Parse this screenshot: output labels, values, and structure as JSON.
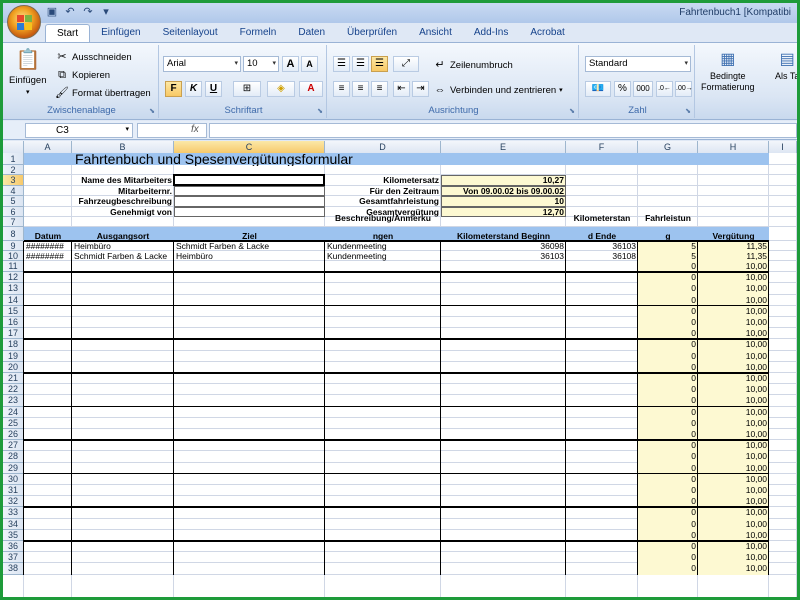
{
  "window": {
    "title": "Fahrtenbuch1  [Kompatibi"
  },
  "qat": [
    {
      "icon": "save-icon",
      "glyph": "▣"
    },
    {
      "icon": "undo-icon",
      "glyph": "↶"
    },
    {
      "icon": "redo-icon",
      "glyph": "↷"
    },
    {
      "icon": "qat-dropdown-icon",
      "glyph": "▾"
    }
  ],
  "tabs": [
    "Start",
    "Einfügen",
    "Seitenlayout",
    "Formeln",
    "Daten",
    "Überprüfen",
    "Ansicht",
    "Add-Ins",
    "Acrobat"
  ],
  "ribbon": {
    "clipboard": {
      "label": "Zwischenablage",
      "paste": "Einfügen",
      "cut": "Ausschneiden",
      "copy": "Kopieren",
      "format_painter": "Format übertragen"
    },
    "font": {
      "label": "Schriftart",
      "name": "Arial",
      "size": "10",
      "bold": "F",
      "italic": "K",
      "underline": "U",
      "grow": "A",
      "shrink": "A",
      "color": "A"
    },
    "alignment": {
      "label": "Ausrichtung",
      "wrap": "Zeilenumbruch",
      "merge": "Verbinden und zentrieren"
    },
    "number": {
      "label": "Zahl",
      "format": "Standard",
      "percent": "%",
      "thousands": "000"
    },
    "styles": {
      "cond_format": "Bedingte",
      "cond_format2": "Formatierung",
      "as_table": "Als Ta"
    }
  },
  "formula_bar": {
    "name_box": "C3",
    "fx": "fx",
    "content": ""
  },
  "columns": [
    "A",
    "B",
    "C",
    "D",
    "E",
    "F",
    "G",
    "H",
    "I"
  ],
  "selected_column": "C",
  "rows": [
    "1",
    "2",
    "3",
    "4",
    "5",
    "6",
    "7",
    "8",
    "9",
    "10",
    "11",
    "12",
    "13",
    "14",
    "15",
    "16",
    "17",
    "18",
    "19",
    "20",
    "21",
    "22",
    "23",
    "24",
    "25",
    "26",
    "27",
    "28",
    "29",
    "30",
    "31",
    "32",
    "33",
    "34",
    "35",
    "36",
    "37",
    "38"
  ],
  "sheet": {
    "title": "Fahrtenbuch und Spesenvergütungsformular",
    "labels_left": [
      "Name des Mitarbeiters",
      "Mitarbeiternr.",
      "Fahrzeugbeschreibung",
      "Genehmigt von"
    ],
    "labels_right": [
      "Kilometersatz",
      "Für den Zeitraum",
      "Gesamtfahrleistung",
      "Gesamtvergütung"
    ],
    "values_right": [
      "10,27",
      "Von 09.00.02 bis 09.00.02",
      "10",
      "12,70"
    ],
    "headers": {
      "datum": "Datum",
      "ausgangsort": "Ausgangsort",
      "ziel": "Ziel",
      "beschreibung1": "Beschreibung/Anmerku",
      "beschreibung2": "ngen",
      "km_beginn": "Kilometerstand Beginn",
      "km_ende1": "Kilometerstan",
      "km_ende2": "d Ende",
      "fahrleistung1": "Fahrleistun",
      "fahrleistung2": "g",
      "verguetung": "Vergütung"
    },
    "data_rows": [
      {
        "datum": "########",
        "ausgangsort": "Heimbüro",
        "ziel": "Schmidt Farben & Lacke",
        "beschreibung": "Kundenmeeting",
        "km_beginn": "36098",
        "km_ende": "36103",
        "fahrleistung": "5",
        "verguetung": "11,35"
      },
      {
        "datum": "########",
        "ausgangsort": "Schmidt Farben & Lacke",
        "ziel": "Heimbüro",
        "beschreibung": "Kundenmeeting",
        "km_beginn": "36103",
        "km_ende": "36108",
        "fahrleistung": "5",
        "verguetung": "11,35"
      }
    ],
    "empty_fahrleistung": "0",
    "empty_verguetung": "10,00"
  },
  "colors": {
    "accent": "#1e9b3a",
    "header_fill": "#9dc3ef",
    "yellow_fill": "#fdf9d2",
    "selected": "#f7c96b"
  }
}
